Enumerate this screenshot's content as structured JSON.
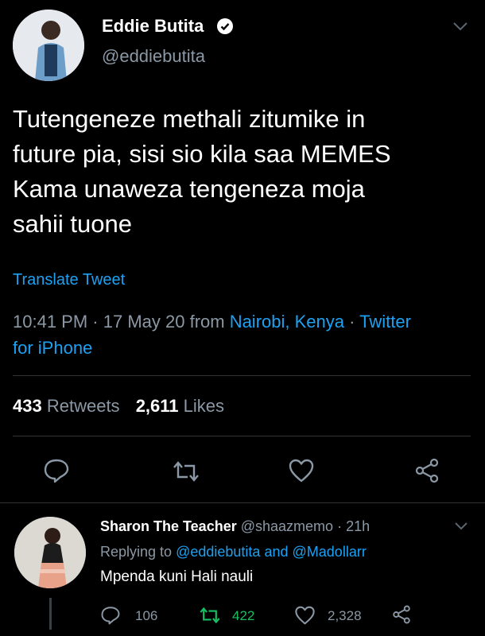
{
  "tweet": {
    "author_name": "Eddie Butita",
    "author_handle": "@eddiebutita",
    "text_lines": [
      "Tutengeneze methali zitumike in",
      "future pia, sisi sio kila saa MEMES",
      "Kama unaweza tengeneza moja",
      "sahii tuone"
    ],
    "translate_label": "Translate Tweet",
    "time": "10:41 PM",
    "date_prefix": "· 17 May 20 from ",
    "location": "Nairobi, Kenya",
    "source_sep": " · ",
    "source_line1": "Twitter",
    "source_line2": "for iPhone",
    "retweets_count": "433",
    "retweets_label": "Retweets",
    "likes_count": "2,611",
    "likes_label": "Likes"
  },
  "reply": {
    "author_name": "Sharon The Teacher",
    "author_handle": "@shaazmemo",
    "time": "· 21h",
    "replying_prefix": "Replying to",
    "mention1": "@eddiebutita",
    "and_word": "and",
    "mention2": "@Madollarr",
    "text": "Mpenda kuni Hali nauli",
    "reply_count": "106",
    "retweet_count": "422",
    "like_count": "2,328"
  },
  "colors": {
    "background": "#000000",
    "link": "#1da1f2",
    "muted": "#8b98a5",
    "retweet_green": "#17bf63"
  },
  "icons": [
    "verified-badge-icon",
    "chevron-down-icon",
    "reply-icon",
    "retweet-icon",
    "like-icon",
    "share-icon"
  ]
}
